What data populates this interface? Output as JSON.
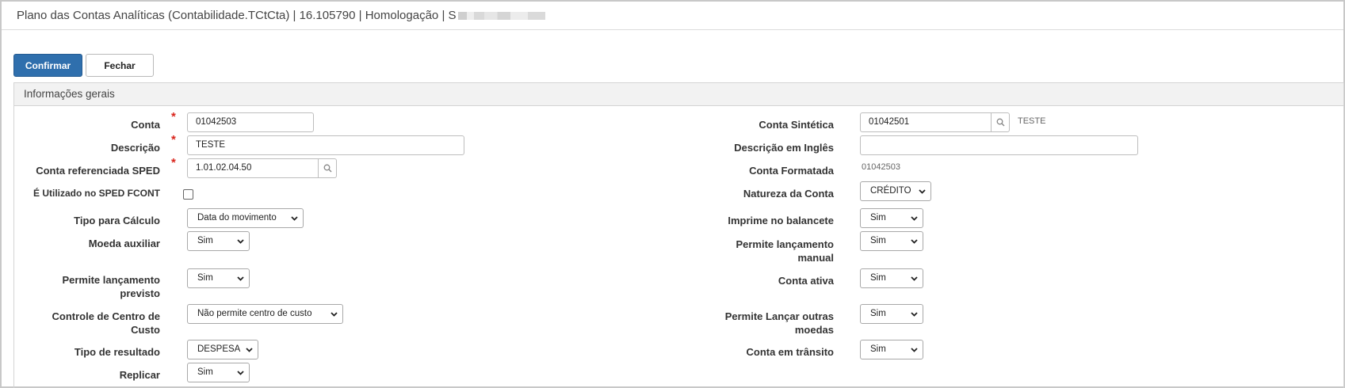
{
  "window": {
    "title": "Plano das Contas Analíticas (Contabilidade.TCtCta) | 16.105790 | Homologação | S"
  },
  "toolbar": {
    "confirm_label": "Confirmar",
    "close_label": "Fechar"
  },
  "section": {
    "title": "Informações gerais"
  },
  "left": {
    "conta": {
      "label": "Conta",
      "value": "01042503"
    },
    "descricao": {
      "label": "Descrição",
      "value": "TESTE"
    },
    "sped": {
      "label": "Conta referenciada SPED",
      "value": "1.01.02.04.50"
    },
    "fcont": {
      "label": "É Utilizado no SPED FCONT",
      "checked": false
    },
    "tipo_calculo": {
      "label": "Tipo para Cálculo",
      "value": "Data do movimento"
    },
    "moeda_aux": {
      "label": "Moeda auxiliar",
      "value": "Sim"
    },
    "lanc_previsto": {
      "label_1": "Permite lançamento",
      "label_2": "previsto",
      "value": "Sim"
    },
    "centro_custo": {
      "label_1": "Controle de Centro de",
      "label_2": "Custo",
      "value": "Não permite centro de custo"
    },
    "tipo_resultado": {
      "label": "Tipo de resultado",
      "value": "DESPESA"
    },
    "replicar": {
      "label": "Replicar",
      "value": "Sim"
    }
  },
  "right": {
    "conta_sintetica": {
      "label": "Conta Sintética",
      "value": "01042501",
      "desc": "TESTE"
    },
    "descricao_ingles": {
      "label": "Descrição em Inglês",
      "value": ""
    },
    "conta_formatada": {
      "label": "Conta Formatada",
      "value": "01042503"
    },
    "natureza": {
      "label": "Natureza da Conta",
      "value": "CRÉDITO"
    },
    "imprime_balancete": {
      "label": "Imprime no balancete",
      "value": "Sim"
    },
    "lanc_manual": {
      "label_1": "Permite lançamento",
      "label_2": "manual",
      "value": "Sim"
    },
    "conta_ativa": {
      "label": "Conta ativa",
      "value": "Sim"
    },
    "outras_moedas": {
      "label_1": "Permite Lançar outras",
      "label_2": "moedas",
      "value": "Sim"
    },
    "conta_transito": {
      "label": "Conta em trânsito",
      "value": "Sim"
    }
  },
  "required_mark": "*",
  "icons": {
    "lookup": "search-icon",
    "dropdown": "chevron-down-icon"
  }
}
